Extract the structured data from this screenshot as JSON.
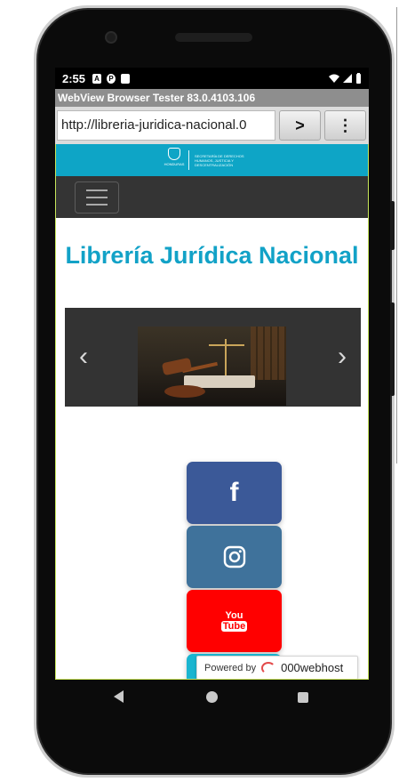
{
  "status_bar": {
    "time": "2:55",
    "notification_icons": [
      "a-icon",
      "p-icon",
      "sd-card-icon"
    ],
    "system_icons": [
      "wifi-icon",
      "signal-icon",
      "battery-icon"
    ]
  },
  "browser": {
    "app_title": "WebView Browser Tester 83.0.4103.106",
    "url": "http://libreria-juridica-nacional.0",
    "go_label": ">",
    "menu_label": "⋮"
  },
  "site": {
    "gov_label": "HONDURAS",
    "gov_ministry": "SECRETARÍA DE DERECHOS HUMANOS, JUSTICIA Y DESCENTRALIZACIÓN",
    "title": "Librería Jurídica Nacional",
    "carousel": {
      "prev_label": "‹",
      "next_label": "›"
    },
    "social": [
      {
        "name": "facebook",
        "color": "#3b5998"
      },
      {
        "name": "instagram",
        "color": "#3f729b"
      },
      {
        "name": "youtube",
        "color": "#ff0000",
        "text_top": "You",
        "text_bottom": "Tube"
      }
    ],
    "fb_glyph": "f",
    "powered": {
      "prefix": "Powered by",
      "brand": "000webhost"
    }
  },
  "colors": {
    "accent": "#0ea5c6",
    "title": "#12a2c7",
    "navbar": "#343434"
  }
}
